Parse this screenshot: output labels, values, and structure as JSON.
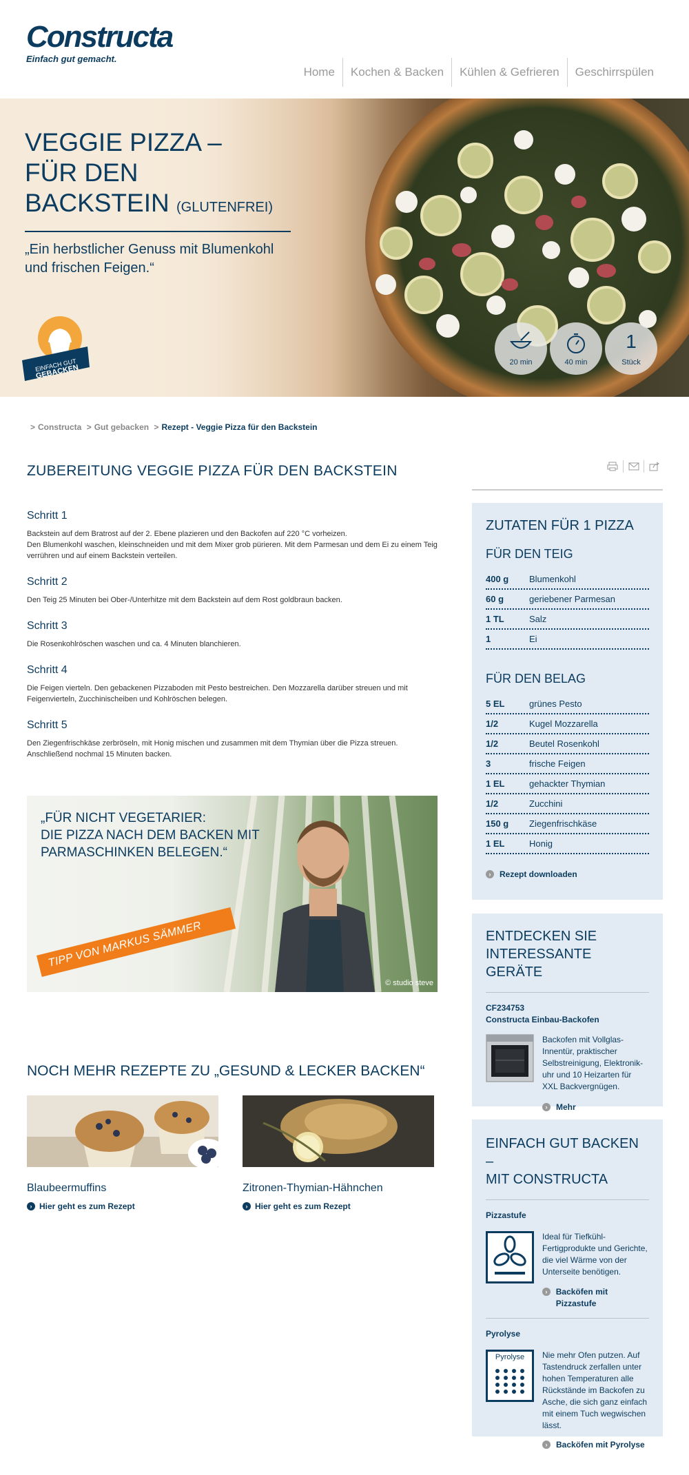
{
  "brand": {
    "name": "Constructa",
    "tagline": "Einfach gut gemacht."
  },
  "nav": {
    "items": [
      "Home",
      "Kochen & Backen",
      "Kühlen & Gefrieren",
      "Geschirrspülen"
    ]
  },
  "hero": {
    "title_line1": "VEGGIE PIZZA –",
    "title_line2": "FÜR DEN",
    "title_line3": "BACKSTEIN",
    "title_suffix": "(GLUTENFREI)",
    "subtitle": "„Ein herbstlicher Genuss mit Blumenkohl und frischen Feigen.“",
    "badge_line1": "EINFACH GUT",
    "badge_line2": "GEBACKEN",
    "info": [
      {
        "label": "20 min",
        "icon": "mixing-bowl-icon"
      },
      {
        "label": "40 min",
        "icon": "stopwatch-icon"
      },
      {
        "value": "1",
        "label": "Stück"
      }
    ]
  },
  "breadcrumb": {
    "items": [
      "Constructa",
      "Gut gebacken",
      "Rezept - Veggie Pizza für den Backstein"
    ]
  },
  "main": {
    "title": "ZUBEREITUNG VEGGIE PIZZA FÜR DEN BACKSTEIN",
    "tools": [
      "print-icon",
      "mail-icon",
      "share-icon"
    ],
    "steps": [
      {
        "title": "Schritt 1",
        "text": "Backstein auf dem Bratrost auf der 2. Ebene plazieren und den Backofen auf 220 °C vorheizen.\nDen Blumenkohl waschen, kleinschneiden und mit dem Mixer grob pürieren. Mit dem Parmesan und dem Ei zu einem Teig verrühren und auf einem Backstein verteilen."
      },
      {
        "title": "Schritt 2",
        "text": "Den Teig 25 Minuten bei Ober-/Unterhitze mit dem Backstein auf dem Rost goldbraun backen."
      },
      {
        "title": "Schritt 3",
        "text": "Die Rosenkohlröschen waschen und ca. 4 Minuten blanchieren."
      },
      {
        "title": "Schritt 4",
        "text": "Die Feigen vierteln. Den gebackenen Pizzaboden mit Pesto bestreichen. Den Mozzarella darüber streuen und mit Feigenvierteln, Zucchinischeiben und Kohlröschen belegen."
      },
      {
        "title": "Schritt 5",
        "text": "Den Ziegenfrischkäse zerbröseln, mit Honig mischen und zusammen mit dem Thymian über die Pizza streuen. Anschließend nochmal 15 Minuten backen."
      }
    ]
  },
  "tip": {
    "quote_line1": "„FÜR NICHT VEGETARIER:",
    "quote_line2": "DIE PIZZA NACH DEM BACKEN MIT",
    "quote_line3": "PARMASCHINKEN BELEGEN.“",
    "banner": "TIPP VON MARKUS SÄMMER",
    "credit": "© studio steve"
  },
  "more": {
    "title": "NOCH MEHR REZEPTE ZU „GESUND & LECKER BACKEN“",
    "recipes": [
      {
        "name": "Blaubeermuffins",
        "link": "Hier geht es zum Rezept"
      },
      {
        "name": "Zitronen-Thymian-Hähnchen",
        "link": "Hier geht es zum Rezept"
      }
    ]
  },
  "ingredients": {
    "title": "ZUTATEN FÜR 1 PIZZA",
    "dough_title": "FÜR DEN TEIG",
    "dough": [
      {
        "q": "400 g",
        "name": "Blumenkohl"
      },
      {
        "q": "60 g",
        "name": "geriebener Parmesan"
      },
      {
        "q": "1 TL",
        "name": "Salz"
      },
      {
        "q": "1",
        "name": "Ei"
      }
    ],
    "topping_title": "FÜR DEN BELAG",
    "topping": [
      {
        "q": "5 EL",
        "name": "grünes Pesto"
      },
      {
        "q": "1/2",
        "name": "Kugel Mozzarella"
      },
      {
        "q": "1/2",
        "name": "Beutel Rosenkohl"
      },
      {
        "q": "3",
        "name": "frische Feigen"
      },
      {
        "q": "1 EL",
        "name": "gehackter Thymian"
      },
      {
        "q": "1/2",
        "name": "Zucchini"
      },
      {
        "q": "150 g",
        "name": "Ziegenfrischkäse"
      },
      {
        "q": "1 EL",
        "name": "Honig"
      }
    ],
    "download": "Rezept downloaden"
  },
  "devices": {
    "title_line1": "ENTDECKEN SIE",
    "title_line2": "INTERESSANTE GERÄTE",
    "model": "CF234753",
    "product": "Constructa Einbau-Backofen",
    "desc": "Backofen mit Vollglas-Innentür, praktischer Selbstreinigung, Elektronik-uhr und 10 Heizarten für XXL Backvergnügen.",
    "more": "Mehr"
  },
  "features": {
    "title_line1": "EINFACH GUT BACKEN –",
    "title_line2": "MIT CONSTRUCTA",
    "items": [
      {
        "title": "Pizzastufe",
        "icon": "pizza-setting-icon",
        "text": "Ideal für Tiefkühl-Fertigprodukte und Gerichte, die viel Wärme von der Unterseite benötigen.",
        "link": "Backöfen mit Pizzastufe"
      },
      {
        "title": "Pyrolyse",
        "icon_label": "Pyrolyse",
        "text": "Nie mehr Ofen putzen. Auf Tastendruck zerfallen unter hohen Temperaturen alle Rückstände im Backofen zu Asche, die sich ganz einfach mit einem Tuch wegwischen lässt.",
        "link": "Backöfen mit Pyrolyse"
      }
    ]
  },
  "colors": {
    "navy": "#0b3b5e",
    "orange": "#f07d1a",
    "sidebar_bg": "#e2ebf3"
  }
}
